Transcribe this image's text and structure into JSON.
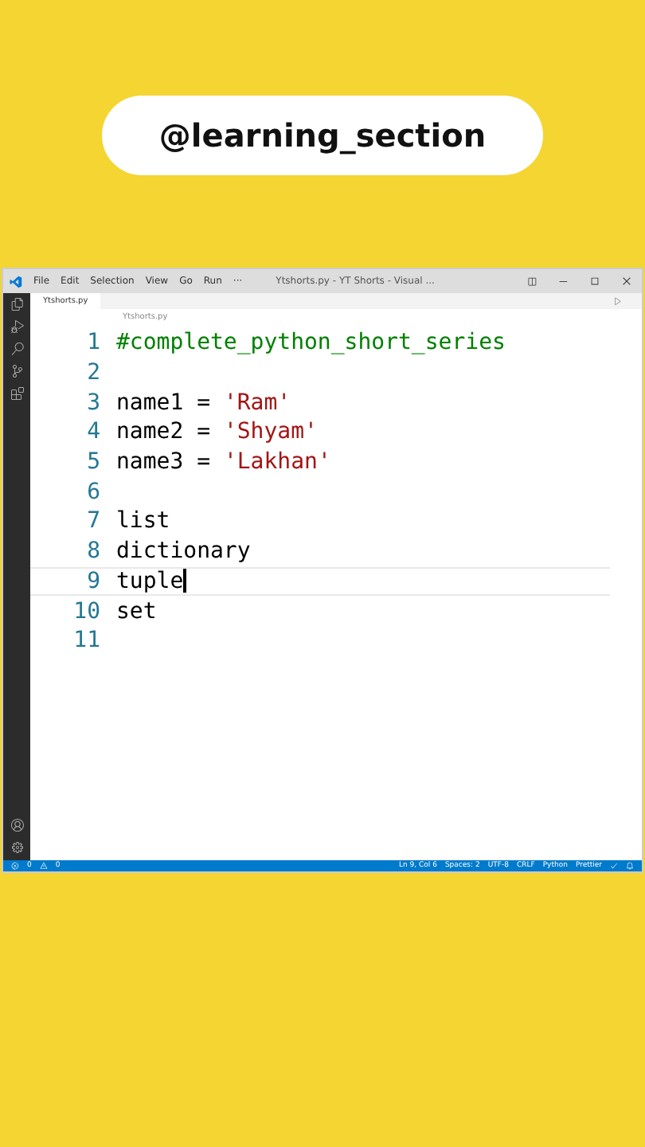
{
  "badge": "@learning_section",
  "window": {
    "title": "Ytshorts.py - YT Shorts - Visual ...",
    "menu": [
      "File",
      "Edit",
      "Selection",
      "View",
      "Go",
      "Run",
      "···"
    ]
  },
  "tabs": [
    {
      "label": "Ytshorts.py",
      "selected": true
    }
  ],
  "breadcrumb": "Ytshorts.py",
  "lines": [
    {
      "number": "1",
      "current": false,
      "tokens": [
        {
          "kind": "comment",
          "text": "#complete_python_short_series"
        }
      ]
    },
    {
      "number": "2",
      "current": false
    },
    {
      "number": "3",
      "current": false,
      "tokens": [
        {
          "kind": "plain",
          "text": "name1 = "
        },
        {
          "kind": "string",
          "text": "'Ram'"
        }
      ]
    },
    {
      "number": "4",
      "current": false,
      "tokens": [
        {
          "kind": "plain",
          "text": "name2 = "
        },
        {
          "kind": "string",
          "text": "'Shyam'"
        }
      ]
    },
    {
      "number": "5",
      "current": false,
      "tokens": [
        {
          "kind": "plain",
          "text": "name3 = "
        },
        {
          "kind": "string",
          "text": "'Lakhan'"
        }
      ]
    },
    {
      "number": "6",
      "current": false
    },
    {
      "number": "7",
      "current": false,
      "tokens": [
        {
          "kind": "plain",
          "text": "list"
        }
      ]
    },
    {
      "number": "8",
      "current": false,
      "tokens": [
        {
          "kind": "plain",
          "text": "dictionary"
        }
      ]
    },
    {
      "number": "9",
      "current": true,
      "tokens": [
        {
          "kind": "plain",
          "text": "tuple"
        }
      ]
    },
    {
      "number": "10",
      "current": false,
      "tokens": [
        {
          "kind": "plain",
          "text": "set"
        }
      ]
    },
    {
      "number": "11",
      "current": false
    }
  ],
  "status_bar": {
    "errors": "0",
    "warnings": "0",
    "items": [
      "Ln 9, Col 6",
      "Spaces: 2",
      "UTF-8",
      "CRLF",
      "Python",
      "Prettier"
    ]
  }
}
